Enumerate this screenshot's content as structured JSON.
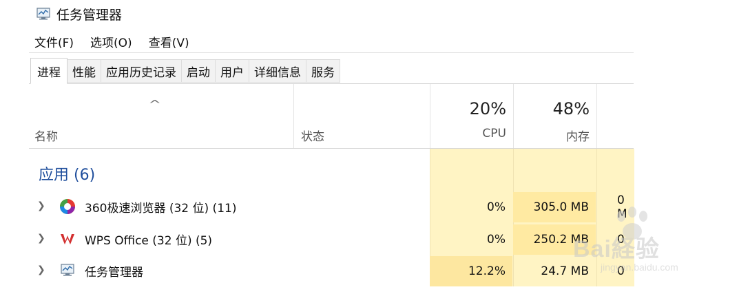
{
  "window": {
    "title": "任务管理器"
  },
  "menu": {
    "file": "文件(F)",
    "options": "选项(O)",
    "view": "查看(V)"
  },
  "tabs": [
    {
      "label": "进程",
      "active": true
    },
    {
      "label": "性能"
    },
    {
      "label": "应用历史记录"
    },
    {
      "label": "启动"
    },
    {
      "label": "用户"
    },
    {
      "label": "详细信息"
    },
    {
      "label": "服务"
    }
  ],
  "columns": {
    "name": "名称",
    "status": "状态",
    "cpu": {
      "percent": "20%",
      "label": "CPU"
    },
    "memory": {
      "percent": "48%",
      "label": "内存"
    }
  },
  "group": {
    "label": "应用 (6)"
  },
  "rows": [
    {
      "name": "360极速浏览器 (32 位) (11)",
      "icon": "browser-360-icon",
      "cpu": "0%",
      "memory": "305.0 MB",
      "disk": "0 M"
    },
    {
      "name": "WPS Office (32 位) (5)",
      "icon": "wps-office-icon",
      "cpu": "0%",
      "memory": "250.2 MB",
      "disk": "0"
    },
    {
      "name": "任务管理器",
      "icon": "task-manager-icon",
      "cpu": "12.2%",
      "memory": "24.7 MB",
      "disk": "0"
    }
  ],
  "watermark": {
    "brand": "Bai経验",
    "url": "jingyan.baidu.com"
  },
  "colors": {
    "group_text": "#1f4e9c",
    "heat_light": "#fff4c4",
    "heat_mid": "#ffeaa2",
    "heat_strong": "#fde7a0"
  }
}
